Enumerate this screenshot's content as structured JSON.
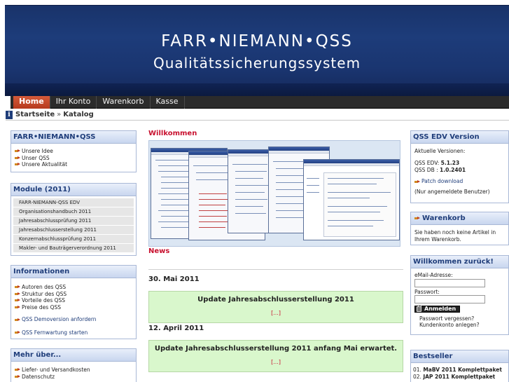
{
  "header": {
    "brand_name": "FARR•NIEMANN•QSS",
    "brand_sub": "Qualitätssicherungssystem"
  },
  "nav": {
    "items": [
      {
        "label": "Home",
        "active": true
      },
      {
        "label": "Ihr Konto"
      },
      {
        "label": "Warenkorb"
      },
      {
        "label": "Kasse"
      }
    ]
  },
  "breadcrumb": {
    "home": "Startseite",
    "sep": "»",
    "current": "Katalog"
  },
  "left": {
    "company": {
      "title": "FARR•NIEMANN•QSS",
      "links": [
        "Unsere Idee",
        "Unser QSS",
        "Unsere Aktualität"
      ]
    },
    "modules": {
      "title": "Module (2011)",
      "items": [
        "FARR-NIEMANN-QSS EDV",
        "Organisationshandbuch 2011",
        "Jahresabschlussprüfung 2011",
        "Jahresabschlusserstellung 2011",
        "Konzernabschlussprüfung 2011",
        "Makler- und Bauträgerverordnung 2011"
      ]
    },
    "info": {
      "title": "Informationen",
      "links": [
        "Autoren des QSS",
        "Struktur des QSS",
        "Vorteile des QSS",
        "Preise des QSS"
      ],
      "actions": [
        "QSS Demoversion anfordern",
        "QSS Fernwartung starten"
      ]
    },
    "more": {
      "title": "Mehr über...",
      "links": [
        "Liefer- und Versandkosten",
        "Datenschutz"
      ]
    }
  },
  "main": {
    "welcome_heading": "Willkommen",
    "news_heading": "News",
    "news": [
      {
        "date": "30. Mai 2011",
        "title": "Update Jahresabschlusserstellung 2011",
        "more": "[...]"
      },
      {
        "date": "12. April 2011",
        "title": "Update Jahresabschlusserstellung 2011 anfang Mai erwartet.",
        "more": "[...]"
      }
    ]
  },
  "right": {
    "version": {
      "title": "QSS EDV Version",
      "intro": "Aktuelle Versionen:",
      "edv_label": "QSS EDV:",
      "edv_value": "5.1.23",
      "db_label": "QSS DB  :",
      "db_value": "1.0.2401",
      "patch": "Patch download",
      "note": "(Nur angemeldete Benutzer)"
    },
    "cart": {
      "title": "Warenkorb",
      "text": "Sie haben noch keine Artikel in Ihrem Warenkorb."
    },
    "login": {
      "title": "Willkommen zurück!",
      "email_label": "eMail-Adresse:",
      "password_label": "Passwort:",
      "button": "Anmelden",
      "forgot": "Passwort vergessen?",
      "create": "Kundenkonto anlegen?"
    },
    "bestseller": {
      "title": "Bestseller",
      "items": [
        {
          "num": "01.",
          "label": "MaBV 2011 Komplettpaket"
        },
        {
          "num": "02.",
          "label": "JAP 2011 Komplettpaket"
        }
      ]
    }
  },
  "colors": {
    "banner": "#1d3c7a",
    "accent_red": "#c8102e",
    "nav_active": "#c4472a",
    "news_bg": "#d9f7cc",
    "box_head": "#c8d6ef"
  }
}
